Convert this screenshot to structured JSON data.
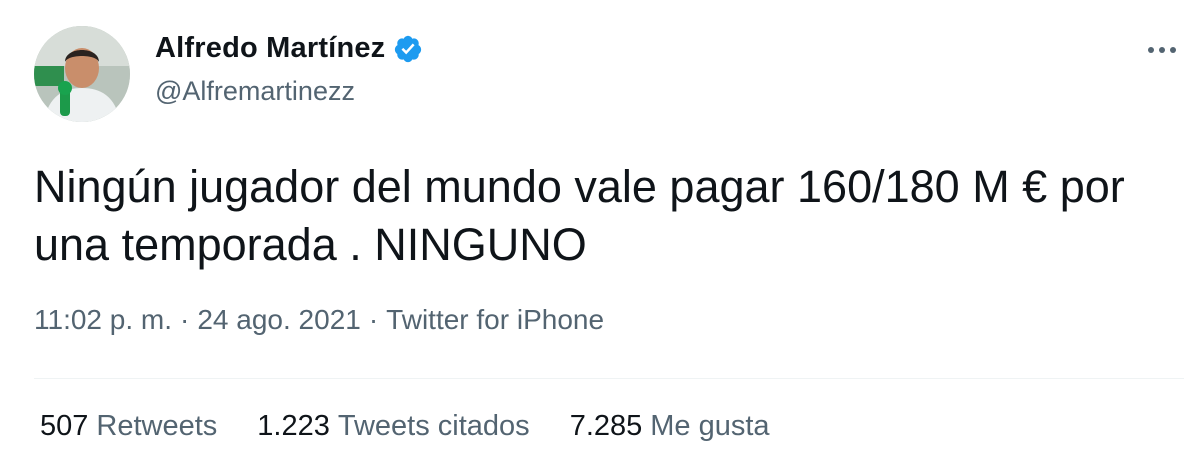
{
  "author": {
    "name": "Alfredo Martínez",
    "handle": "@Alfremartinezz",
    "verified_color": "#1d9bf0"
  },
  "tweet": {
    "text": "Ningún jugador del mundo vale pagar 160/180 M € por una temporada . NINGUNO",
    "time": "11:02 p. m.",
    "separator": "·",
    "date": "24 ago. 2021",
    "source": "Twitter for iPhone"
  },
  "stats": {
    "retweets_count": "507",
    "retweets_label": "Retweets",
    "quotes_count": "1.223",
    "quotes_label": "Tweets citados",
    "likes_count": "7.285",
    "likes_label": "Me gusta"
  },
  "icons": {
    "verified": "verified-badge-icon",
    "more": "more-options-icon"
  }
}
